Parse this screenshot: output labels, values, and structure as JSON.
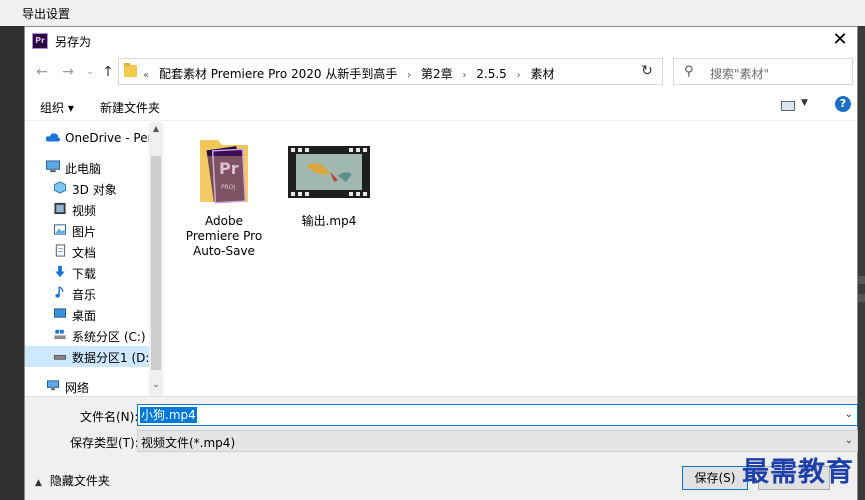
{
  "background_app": {
    "title": "导出设置"
  },
  "dialog": {
    "title": "另存为",
    "app_icon_text": "Pr"
  },
  "address_bar": {
    "overflow": "«",
    "crumbs": [
      "配套素材 Premiere Pro 2020 从新手到高手",
      "第2章",
      "2.5.5",
      "素材"
    ],
    "separator": "›"
  },
  "search": {
    "placeholder": "搜索\"素材\""
  },
  "toolbar": {
    "organize_label": "组织 ▾",
    "new_folder_label": "新建文件夹",
    "help_label": "?"
  },
  "nav_pane": {
    "items": [
      {
        "label": "OneDrive - Perso",
        "icon": "cloud-icon"
      },
      {
        "label": "此电脑",
        "icon": "computer-icon"
      },
      {
        "label": "3D 对象",
        "icon": "cube-icon"
      },
      {
        "label": "视频",
        "icon": "video-icon"
      },
      {
        "label": "图片",
        "icon": "picture-icon"
      },
      {
        "label": "文档",
        "icon": "document-icon"
      },
      {
        "label": "下载",
        "icon": "download-icon"
      },
      {
        "label": "音乐",
        "icon": "music-icon"
      },
      {
        "label": "桌面",
        "icon": "desktop-icon"
      },
      {
        "label": "系统分区 (C:)",
        "icon": "drive-c-icon"
      },
      {
        "label": "数据分区1 (D:)",
        "icon": "drive-d-icon",
        "selected": true
      },
      {
        "label": "网络",
        "icon": "network-icon"
      }
    ]
  },
  "files": [
    {
      "name": "Adobe Premiere Pro Auto-Save",
      "icon": "premiere-folder-icon"
    },
    {
      "name": "输出.mp4",
      "icon": "video-thumbnail-icon"
    }
  ],
  "form": {
    "filename_label": "文件名(N):",
    "filename_value": "小狗.mp4",
    "filetype_label": "保存类型(T):",
    "filetype_value": "视频文件(*.mp4)",
    "hide_folders_label": "隐藏文件夹",
    "save_label": "保存(S)"
  },
  "watermark": {
    "text": "最需教育"
  },
  "colors": {
    "accent": "#0078d7",
    "selection": "#cde8ff",
    "watermark": "#1c3fa8"
  }
}
